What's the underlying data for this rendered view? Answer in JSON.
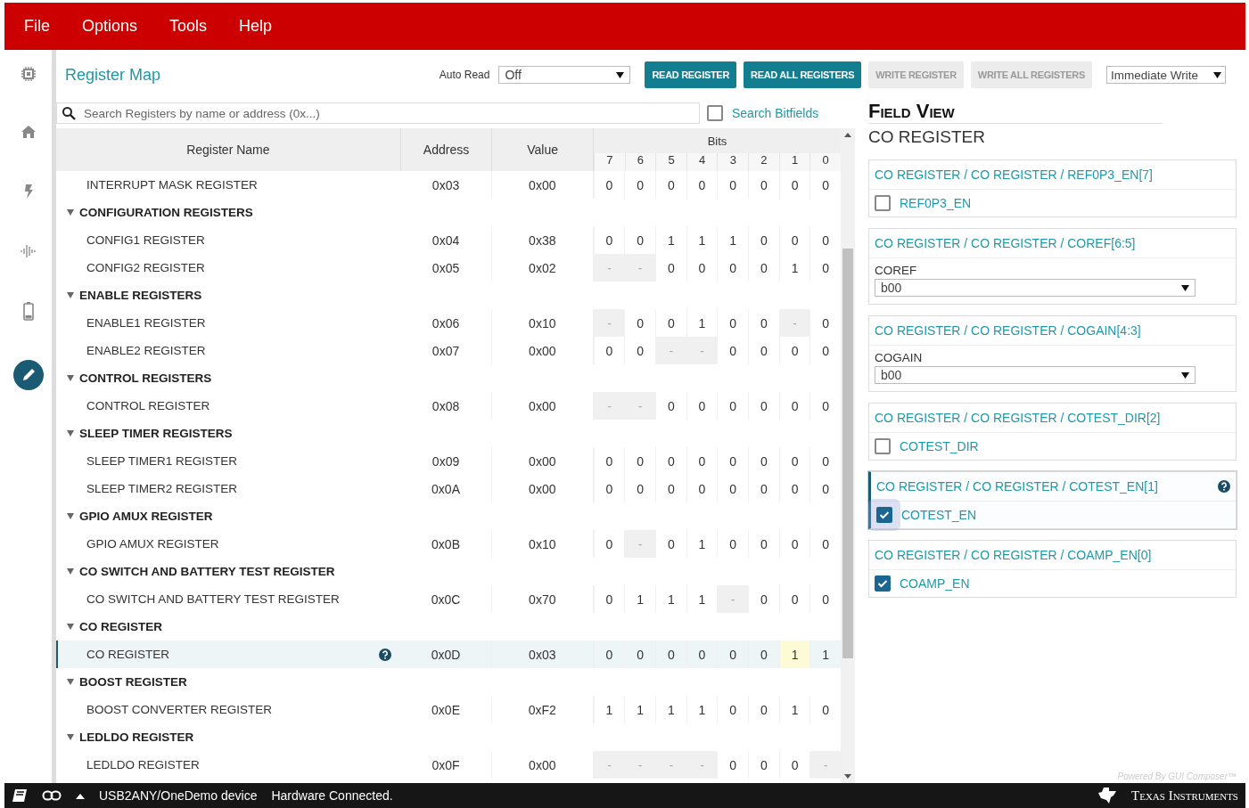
{
  "menu": [
    "File",
    "Options",
    "Tools",
    "Help"
  ],
  "sidebar": {
    "items": [
      {
        "selected": false
      },
      {
        "selected": false
      },
      {
        "selected": false
      },
      {
        "selected": false
      },
      {
        "selected": false
      },
      {
        "selected": true
      }
    ]
  },
  "toolbar": {
    "title": "Register Map",
    "auto_read_label": "Auto Read",
    "auto_read_value": "Off",
    "buttons": [
      {
        "label": "READ REGISTER",
        "disabled": false
      },
      {
        "label": "READ ALL REGISTERS",
        "disabled": false
      },
      {
        "label": "WRITE REGISTER",
        "disabled": true
      },
      {
        "label": "WRITE ALL REGISTERS",
        "disabled": true
      }
    ],
    "write_mode": "Immediate Write"
  },
  "search": {
    "placeholder": "Search Registers by name or address (0x...)",
    "bitfields_label": "Search Bitfields",
    "bitfields_checked": false
  },
  "table": {
    "columns": [
      "Register Name",
      "Address",
      "Value",
      "Bits"
    ],
    "bit_labels": [
      "7",
      "6",
      "5",
      "4",
      "3",
      "2",
      "1",
      "0"
    ],
    "rows": [
      {
        "kind": "register",
        "name": "INTERRUPT MASK REGISTER",
        "address": "0x03",
        "value": "0x00",
        "bits": [
          "0",
          "0",
          "0",
          "0",
          "0",
          "0",
          "0",
          "0"
        ],
        "reserved": [
          false,
          false,
          false,
          false,
          false,
          false,
          false,
          false
        ],
        "selected": false
      },
      {
        "kind": "group",
        "name": "CONFIGURATION REGISTERS",
        "expanded": true
      },
      {
        "kind": "register",
        "name": "CONFIG1 REGISTER",
        "address": "0x04",
        "value": "0x38",
        "bits": [
          "0",
          "0",
          "1",
          "1",
          "1",
          "0",
          "0",
          "0"
        ],
        "reserved": [
          false,
          false,
          false,
          false,
          false,
          false,
          false,
          false
        ],
        "selected": false
      },
      {
        "kind": "register",
        "name": "CONFIG2 REGISTER",
        "address": "0x05",
        "value": "0x02",
        "bits": [
          "-",
          "-",
          "0",
          "0",
          "0",
          "0",
          "1",
          "0"
        ],
        "reserved": [
          true,
          true,
          false,
          false,
          false,
          false,
          false,
          false
        ],
        "selected": false
      },
      {
        "kind": "group",
        "name": "ENABLE REGISTERS",
        "expanded": true
      },
      {
        "kind": "register",
        "name": "ENABLE1 REGISTER",
        "address": "0x06",
        "value": "0x10",
        "bits": [
          "-",
          "0",
          "0",
          "1",
          "0",
          "0",
          "-",
          "0"
        ],
        "reserved": [
          true,
          false,
          false,
          false,
          false,
          false,
          true,
          false
        ],
        "selected": false
      },
      {
        "kind": "register",
        "name": "ENABLE2 REGISTER",
        "address": "0x07",
        "value": "0x00",
        "bits": [
          "0",
          "0",
          "-",
          "-",
          "0",
          "0",
          "0",
          "0"
        ],
        "reserved": [
          false,
          false,
          true,
          true,
          false,
          false,
          false,
          false
        ],
        "selected": false
      },
      {
        "kind": "group",
        "name": "CONTROL REGISTERS",
        "expanded": true
      },
      {
        "kind": "register",
        "name": "CONTROL REGISTER",
        "address": "0x08",
        "value": "0x00",
        "bits": [
          "-",
          "-",
          "0",
          "0",
          "0",
          "0",
          "0",
          "0"
        ],
        "reserved": [
          true,
          true,
          false,
          false,
          false,
          false,
          false,
          false
        ],
        "selected": false
      },
      {
        "kind": "group",
        "name": "SLEEP TIMER REGISTERS",
        "expanded": true
      },
      {
        "kind": "register",
        "name": "SLEEP TIMER1 REGISTER",
        "address": "0x09",
        "value": "0x00",
        "bits": [
          "0",
          "0",
          "0",
          "0",
          "0",
          "0",
          "0",
          "0"
        ],
        "reserved": [
          false,
          false,
          false,
          false,
          false,
          false,
          false,
          false
        ],
        "selected": false
      },
      {
        "kind": "register",
        "name": "SLEEP TIMER2 REGISTER",
        "address": "0x0A",
        "value": "0x00",
        "bits": [
          "0",
          "0",
          "0",
          "0",
          "0",
          "0",
          "0",
          "0"
        ],
        "reserved": [
          false,
          false,
          false,
          false,
          false,
          false,
          false,
          false
        ],
        "selected": false
      },
      {
        "kind": "group",
        "name": "GPIO AMUX REGISTER",
        "expanded": true
      },
      {
        "kind": "register",
        "name": "GPIO AMUX REGISTER",
        "address": "0x0B",
        "value": "0x10",
        "bits": [
          "0",
          "-",
          "0",
          "1",
          "0",
          "0",
          "0",
          "0"
        ],
        "reserved": [
          false,
          true,
          false,
          false,
          false,
          false,
          false,
          false
        ],
        "selected": false
      },
      {
        "kind": "group",
        "name": "CO SWITCH AND BATTERY TEST REGISTER",
        "expanded": true
      },
      {
        "kind": "register",
        "name": "CO SWITCH AND BATTERY TEST REGISTER",
        "address": "0x0C",
        "value": "0x70",
        "bits": [
          "0",
          "1",
          "1",
          "1",
          "-",
          "0",
          "0",
          "0"
        ],
        "reserved": [
          false,
          false,
          false,
          false,
          true,
          false,
          false,
          false
        ],
        "selected": false
      },
      {
        "kind": "group",
        "name": "CO REGISTER",
        "expanded": true
      },
      {
        "kind": "register",
        "name": "CO REGISTER",
        "address": "0x0D",
        "value": "0x03",
        "bits": [
          "0",
          "0",
          "0",
          "0",
          "0",
          "0",
          "1",
          "1"
        ],
        "reserved": [
          false,
          false,
          false,
          false,
          false,
          false,
          false,
          false
        ],
        "highlighted": [
          false,
          false,
          false,
          false,
          false,
          false,
          true,
          false
        ],
        "selected": true
      },
      {
        "kind": "group",
        "name": "BOOST REGISTER",
        "expanded": true
      },
      {
        "kind": "register",
        "name": "BOOST CONVERTER REGISTER",
        "address": "0x0E",
        "value": "0xF2",
        "bits": [
          "1",
          "1",
          "1",
          "1",
          "0",
          "0",
          "1",
          "0"
        ],
        "reserved": [
          false,
          false,
          false,
          false,
          false,
          false,
          false,
          false
        ],
        "selected": false
      },
      {
        "kind": "group",
        "name": "LEDLDO REGISTER",
        "expanded": true
      },
      {
        "kind": "register",
        "name": "LEDLDO REGISTER",
        "address": "0x0F",
        "value": "0x00",
        "bits": [
          "-",
          "-",
          "-",
          "-",
          "0",
          "0",
          "0",
          "-"
        ],
        "reserved": [
          true,
          true,
          true,
          true,
          false,
          false,
          false,
          true
        ],
        "selected": false
      }
    ]
  },
  "field_view": {
    "title": "Field View",
    "register": "CO REGISTER",
    "fields": [
      {
        "kind": "checkbox",
        "path": "CO REGISTER / CO REGISTER / REF0P3_EN[7]",
        "label": "REF0P3_EN",
        "checked": false,
        "selected": false
      },
      {
        "kind": "select",
        "path": "CO REGISTER / CO REGISTER / COREF[6:5]",
        "label": "COREF",
        "value": "b00",
        "selected": false
      },
      {
        "kind": "select",
        "path": "CO REGISTER / CO REGISTER / COGAIN[4:3]",
        "label": "COGAIN",
        "value": "b00",
        "selected": false
      },
      {
        "kind": "checkbox",
        "path": "CO REGISTER / CO REGISTER / COTEST_DIR[2]",
        "label": "COTEST_DIR",
        "checked": false,
        "selected": false
      },
      {
        "kind": "checkbox",
        "path": "CO REGISTER / CO REGISTER / COTEST_EN[1]",
        "label": "COTEST_EN",
        "checked": true,
        "selected": true
      },
      {
        "kind": "checkbox",
        "path": "CO REGISTER / CO REGISTER / COAMP_EN[0]",
        "label": "COAMP_EN",
        "checked": true,
        "selected": false
      }
    ],
    "powered_by": "Powered By GUI Composer™"
  },
  "status_bar": {
    "device": "USB2ANY/OneDemo device",
    "status": "Hardware Connected.",
    "brand": "Texas Instruments"
  }
}
